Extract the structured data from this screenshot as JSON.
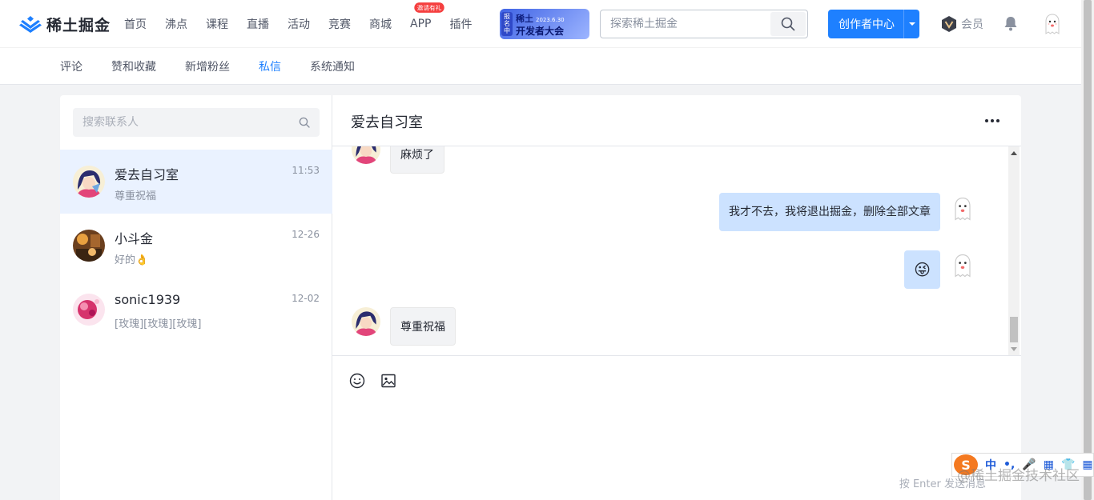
{
  "brand": {
    "name": "稀土掘金"
  },
  "nav": {
    "items": [
      "首页",
      "沸点",
      "课程",
      "直播",
      "活动",
      "竞赛",
      "商城"
    ],
    "app_label": "APP",
    "app_badge": "邀请有礼",
    "plugin_label": "插件"
  },
  "promo": {
    "tag": "报名中",
    "line1": "稀土",
    "date": "2023.6.30",
    "line2": "开发者大会"
  },
  "search": {
    "placeholder": "探索稀土掘金"
  },
  "creator": {
    "label": "创作者中心"
  },
  "vip": {
    "label": "会员"
  },
  "subnav": {
    "items": [
      "评论",
      "赞和收藏",
      "新增粉丝",
      "私信",
      "系统通知"
    ],
    "active_index": 3
  },
  "contacts": {
    "search_placeholder": "搜索联系人",
    "list": [
      {
        "name": "爱去自习室",
        "time": "11:53",
        "preview": "尊重祝福",
        "active": true
      },
      {
        "name": "小斗金",
        "time": "12-26",
        "preview": "好的👌",
        "active": false
      },
      {
        "name": "sonic1939",
        "time": "12-02",
        "preview": "[玫瑰][玫瑰][玫瑰]",
        "active": false
      }
    ]
  },
  "chat": {
    "title": "爱去自习室",
    "messages": [
      {
        "from": "other",
        "text": "麻烦了"
      },
      {
        "from": "me",
        "text": "我才不去，我将退出掘金，删除全部文章"
      },
      {
        "from": "me",
        "text": "😜"
      },
      {
        "from": "other",
        "text": "尊重祝福"
      }
    ],
    "send_hint": "按 Enter 发送消息"
  },
  "ime": {
    "logo": "S",
    "items": [
      "中",
      "•,",
      "🎤",
      "▦",
      "👕",
      "▦"
    ]
  },
  "watermark": "@稀土掘金技术社区",
  "colors": {
    "accent": "#1e80ff",
    "out_bubble": "#cce2ff",
    "in_bubble": "#f2f3f5",
    "active_contact": "#eaf2ff"
  }
}
